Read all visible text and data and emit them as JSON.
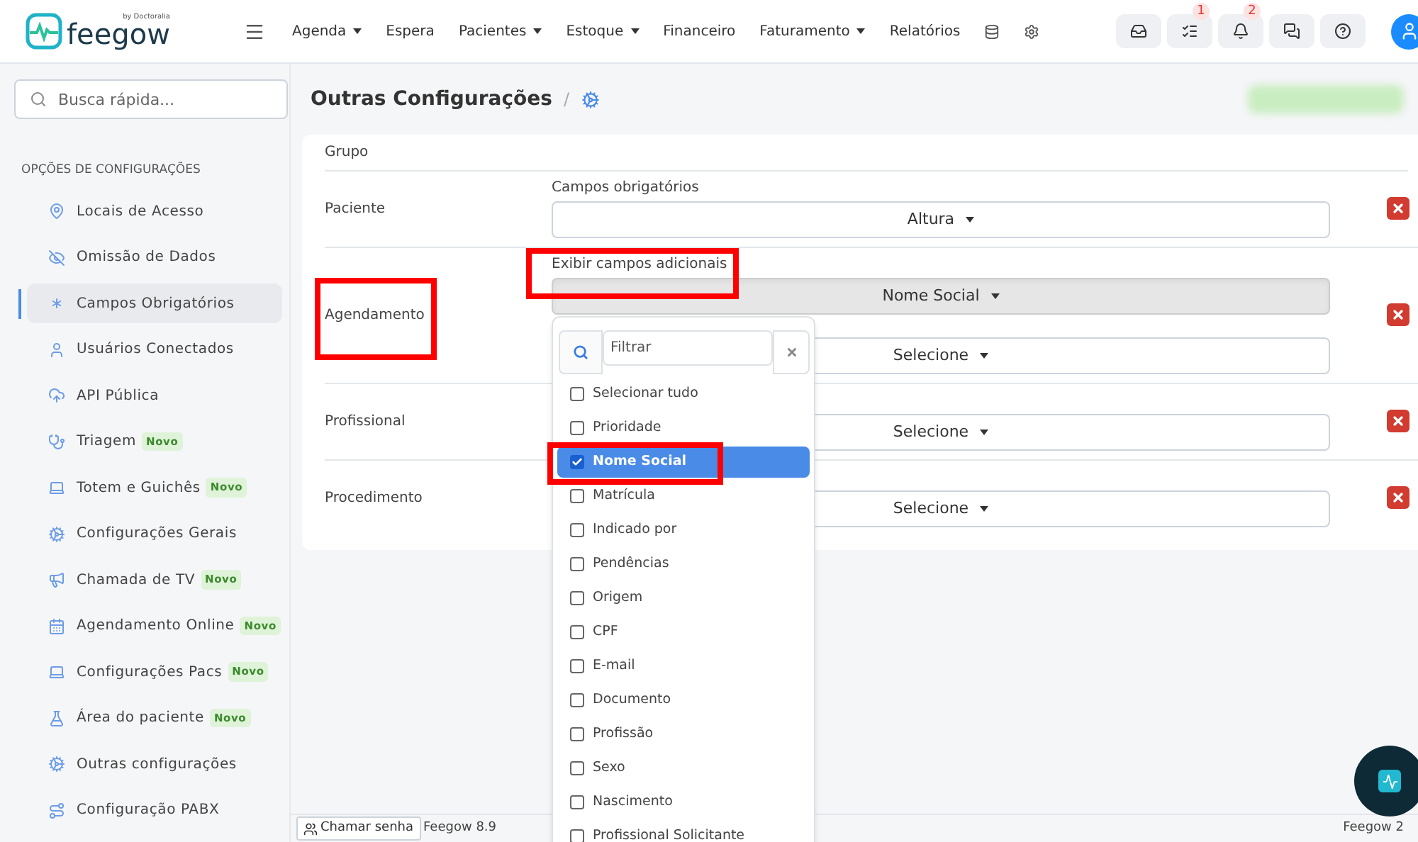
{
  "brand": {
    "name": "feegow",
    "byline": "by Doctoralia"
  },
  "nav": [
    {
      "label": "Agenda",
      "has_menu": true
    },
    {
      "label": "Espera",
      "has_menu": false
    },
    {
      "label": "Pacientes",
      "has_menu": true
    },
    {
      "label": "Estoque",
      "has_menu": true
    },
    {
      "label": "Financeiro",
      "has_menu": false
    },
    {
      "label": "Faturamento",
      "has_menu": true
    },
    {
      "label": "Relatórios",
      "has_menu": false
    }
  ],
  "toolbar": [
    {
      "kind": "inbox"
    },
    {
      "kind": "tasks",
      "badge": "1"
    },
    {
      "kind": "bell",
      "badge": "2"
    },
    {
      "kind": "chat"
    },
    {
      "kind": "help"
    }
  ],
  "search": {
    "placeholder": "Busca rápida..."
  },
  "sidebar": {
    "heading": "OPÇÕES DE CONFIGURAÇÕES",
    "items": [
      {
        "label": "Locais de Acesso",
        "selected": false
      },
      {
        "label": "Omissão de Dados",
        "selected": false
      },
      {
        "label": "Campos Obrigatórios",
        "selected": true
      },
      {
        "label": "Usuários Conectados",
        "selected": false
      },
      {
        "label": "API Pública",
        "selected": false
      },
      {
        "label": "Triagem",
        "selected": false,
        "tag": "Novo"
      },
      {
        "label": "Totem e Guichês",
        "selected": false,
        "tag": "Novo"
      },
      {
        "label": "Configurações Gerais",
        "selected": false
      },
      {
        "label": "Chamada de TV",
        "selected": false,
        "tag": "Novo"
      },
      {
        "label": "Agendamento Online",
        "selected": false,
        "tag": "Novo"
      },
      {
        "label": "Configurações Pacs",
        "selected": false,
        "tag": "Novo"
      },
      {
        "label": "Área do paciente",
        "selected": false,
        "tag": "Novo"
      },
      {
        "label": "Outras configurações",
        "selected": false
      },
      {
        "label": "Configuração PABX",
        "selected": false
      }
    ]
  },
  "page": {
    "title": "Outras Configurações",
    "separator": "/"
  },
  "table": {
    "header": "Grupo",
    "rows": [
      {
        "group": "Paciente",
        "fields": [
          {
            "label": "Campos obrigatórios",
            "value": "Altura",
            "open": false
          }
        ]
      },
      {
        "group": "Agendamento",
        "fields": [
          {
            "label": "Exibir campos adicionais",
            "value": "Nome Social",
            "open": true
          },
          {
            "value": "Selecione",
            "open": false
          }
        ]
      },
      {
        "group": "Profissional",
        "fields": [
          {
            "value": "Selecione",
            "open": false
          }
        ]
      },
      {
        "group": "Procedimento",
        "fields": [
          {
            "value": "Selecione",
            "open": false
          }
        ]
      }
    ]
  },
  "dropdown": {
    "placeholder": "Filtrar",
    "options": [
      {
        "label": "Selecionar tudo",
        "checked": false,
        "selected": false
      },
      {
        "label": "Prioridade",
        "checked": false,
        "selected": false
      },
      {
        "label": "Nome Social",
        "checked": true,
        "selected": true
      },
      {
        "label": "Matrícula",
        "checked": false,
        "selected": false
      },
      {
        "label": "Indicado por",
        "checked": false,
        "selected": false
      },
      {
        "label": "Pendências",
        "checked": false,
        "selected": false
      },
      {
        "label": "Origem",
        "checked": false,
        "selected": false
      },
      {
        "label": "CPF",
        "checked": false,
        "selected": false
      },
      {
        "label": "E-mail",
        "checked": false,
        "selected": false
      },
      {
        "label": "Documento",
        "checked": false,
        "selected": false
      },
      {
        "label": "Profissão",
        "checked": false,
        "selected": false
      },
      {
        "label": "Sexo",
        "checked": false,
        "selected": false
      },
      {
        "label": "Nascimento",
        "checked": false,
        "selected": false
      },
      {
        "label": "Profissional Solicitante",
        "checked": false,
        "selected": false
      }
    ]
  },
  "footer": {
    "button": "Chamar senha",
    "version": "Feegow 8.9",
    "right": "Feegow 2"
  }
}
